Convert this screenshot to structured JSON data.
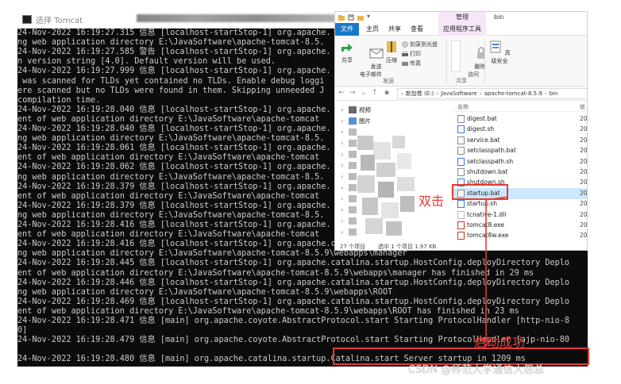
{
  "console": {
    "title": "选择 Tomcat",
    "lines": [
      "24-Nov-2022 16:19:27.315 信息 [localhost-startStop-1] org.apache.",
      "ng web application directory E:\\JavaSoftware\\apache-tomcat-8.5.",
      "24-Nov-2022 16:19:27.585 警告 [localhost-startStop-1] org.apache.",
      "n version string [4.0]. Default version will be used.",
      "24-Nov-2022 16:19:27.999 信息 [localhost-startStop-1] org.apache.",
      " was scanned for TLDs yet contained no TLDs. Enable debug loggi",
      "ere scanned but no TLDs were found in them. Skipping unneeded J",
      "compilation time.",
      "24-Nov-2022 16:19:28.040 信息 [localhost-startStop-1] org.apache.",
      "ent of web application directory E:\\JavaSoftware\\apache-tomcat",
      "24-Nov-2022 16:19:28.040 信息 [localhost-startStop-1] org.apache.",
      "ng web application directory E:\\JavaSoftware\\apache-tomcat-8.5.",
      "24-Nov-2022 16:19:28.061 信息 [localhost-startStop-1] org.apache.",
      "ent of web application directory E:\\JavaSoftware\\apache-tomcat",
      "24-Nov-2022 16:19:28.062 信息 [localhost-startStop-1] org.apache.",
      "ng web application directory E:\\JavaSoftware\\apache-tomcat-8.5.",
      "24-Nov-2022 16:19:28.379 信息 [localhost-startStop-1] org.apache.",
      "ent of web application directory E:\\JavaSoftware\\apache-tomcat",
      "24-Nov-2022 16:19:28.379 信息 [localhost-startStop-1] org.apache.",
      "ng web application directory E:\\JavaSoftware\\apache-tomcat-8.5.",
      "24-Nov-2022 16:19:28.416 信息 [localhost-startStop-1] org.apache.",
      "ent of web application directory E:\\JavaSoftware\\apache-tomcat",
      "24-Nov-2022 16:19:28.416 信息 [localhost-startStop-1] org.apache.catalina.startup.HostConfig.deployDirectory Depl",
      "ng web application directory E:\\JavaSoftware\\apache-tomcat-8.5.9\\webapps\\manager",
      "24-Nov-2022 16:19:28.445 信息 [localhost-startStop-1] org.apache.catalina.startup.HostConfig.deployDirectory Deplo",
      "ent of web application directory E:\\JavaSoftware\\apache-tomcat-8.5.9\\webapps\\manager has finished in 29 ms",
      "24-Nov-2022 16:19:28.446 信息 [localhost-startStop-1] org.apache.catalina.startup.HostConfig.deployDirectory Deplo",
      "ng web application directory E:\\JavaSoftware\\apache-tomcat-8.5.9\\webapps\\ROOT",
      "24-Nov-2022 16:19:28.469 信息 [localhost-startStop-1] org.apache.catalina.startup.HostConfig.deployDirectory Deplo",
      "ent of web application directory E:\\JavaSoftware\\apache-tomcat-8.5.9\\webapps\\ROOT has finished in 23 ms",
      "24-Nov-2022 16:19:28.471 信息 [main] org.apache.coyote.AbstractProtocol.start Starting ProtocolHandler [http-nio-8",
      "0]",
      "24-Nov-2022 16:19:28.479 信息 [main] org.apache.coyote.AbstractProtocol.start Starting ProtocolHandler [ajp-nio-80",
      "",
      "24-Nov-2022 16:19:28.480 信息 [main] org.apache.catalina.startup.Catalina.start Server startup in 1209 ms"
    ]
  },
  "explorer": {
    "window_title": "bin",
    "context_tab": "管理",
    "tabs": [
      "文件",
      "主页",
      "共享",
      "查看",
      "应用程序工具"
    ],
    "ribbon": {
      "share": "共享",
      "send_email": "发送\n电子邮件",
      "zip": "压缩",
      "share_with": "共享",
      "burn": "刻录到光盘",
      "print": "打印",
      "fax": "传真",
      "remove_access": "删除\n访问",
      "advanced_security": "高级安全",
      "group_send": "发送",
      "group_share_with": "共享"
    },
    "address": {
      "crumbs": [
        "新加卷 (E:)",
        "JavaSoftware",
        "apache-tomcat-8.5.9",
        "bin"
      ]
    },
    "nav_items": [
      "视频",
      "图片",
      "",
      "",
      "",
      "",
      "",
      "",
      "",
      "",
      "",
      ""
    ],
    "columns": {
      "name": "名称",
      "date": "修"
    },
    "files": [
      {
        "name": "digest.bat",
        "date": "20",
        "type": "bat",
        "selected": false
      },
      {
        "name": "digest.sh",
        "date": "20",
        "type": "sh",
        "selected": false
      },
      {
        "name": "service.bat",
        "date": "20",
        "type": "bat",
        "selected": false
      },
      {
        "name": "setclasspath.bat",
        "date": "20",
        "type": "bat",
        "selected": false
      },
      {
        "name": "setclasspath.sh",
        "date": "20",
        "type": "sh",
        "selected": false
      },
      {
        "name": "shutdown.bat",
        "date": "20",
        "type": "bat",
        "selected": false
      },
      {
        "name": "shutdown.sh",
        "date": "20",
        "type": "sh",
        "selected": false
      },
      {
        "name": "startup.bat",
        "date": "20",
        "type": "bat",
        "selected": true
      },
      {
        "name": "startup.sh",
        "date": "20",
        "type": "sh",
        "selected": false
      },
      {
        "name": "tcnative-1.dll",
        "date": "20",
        "type": "dll",
        "selected": false
      },
      {
        "name": "tomcat8.exe",
        "date": "20",
        "type": "exe",
        "selected": false
      },
      {
        "name": "tomcat8w.exe",
        "date": "20",
        "type": "exe",
        "selected": false
      }
    ],
    "status": {
      "count": "27 个项目",
      "selected": "选中 1 个项目  1.97 KB"
    }
  },
  "annotations": {
    "double_click": "双击",
    "started": "启动成功",
    "color": "#e53935"
  },
  "watermark": "CSDN @师范大学通信大怨总"
}
